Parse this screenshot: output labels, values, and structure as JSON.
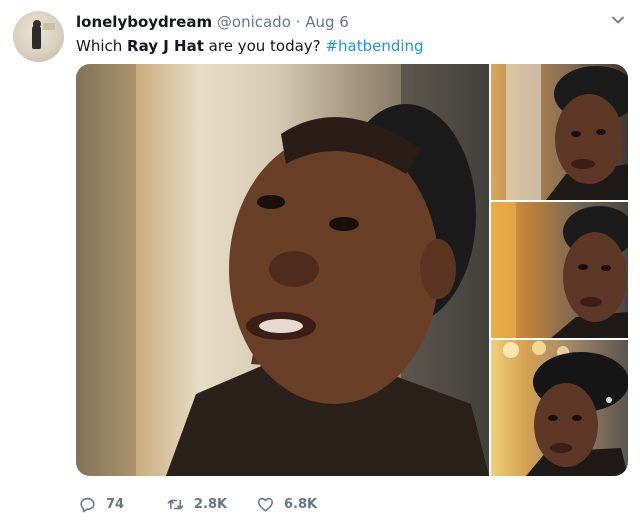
{
  "tweet": {
    "display_name": "lonelyboydream",
    "handle": "@onicado",
    "separator": "·",
    "time": "Aug 6",
    "text_before": "Which ",
    "text_bold": "Ray J Hat",
    "text_after": " are you today? ",
    "hashtag": "#hatbending"
  },
  "actions": {
    "reply_count": "74",
    "retweet_count": "2.8K",
    "like_count": "6.8K"
  },
  "icons": {
    "reply": "reply-icon",
    "retweet": "retweet-icon",
    "like": "heart-icon",
    "caret": "chevron-down-icon"
  },
  "colors": {
    "link": "#1b95e0",
    "muted": "#657786",
    "text": "#14171a"
  }
}
